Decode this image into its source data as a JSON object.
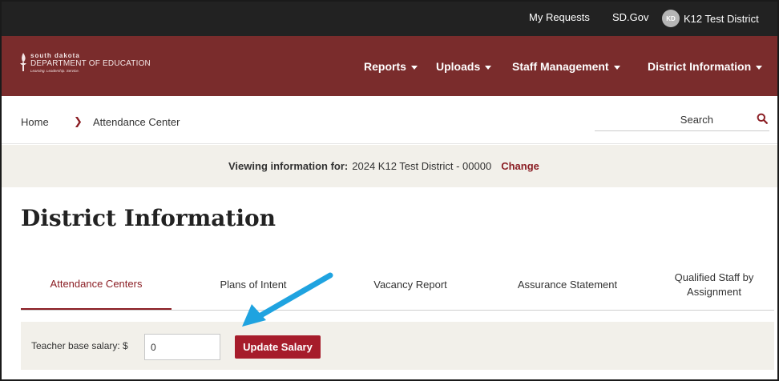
{
  "topbar": {
    "my_requests": "My Requests",
    "sd_gov": "SD.Gov",
    "user_initials": "KD",
    "user_name": "K12 Test District"
  },
  "logo": {
    "line1": "south dakota",
    "line2": "DEPARTMENT OF EDUCATION",
    "tagline": "Learning. Leadership. Service."
  },
  "nav": {
    "reports": "Reports",
    "uploads": "Uploads",
    "staff_management": "Staff Management",
    "district_information": "District Information"
  },
  "breadcrumb": {
    "home": "Home",
    "separator": "❯",
    "current": "Attendance Center"
  },
  "search": {
    "placeholder": "Search"
  },
  "viewing": {
    "label": "Viewing information for:",
    "value": "2024 K12 Test District - 00000",
    "change_link": "Change"
  },
  "page_title": "District Information",
  "tabs": [
    {
      "label": "Attendance Centers",
      "active": true
    },
    {
      "label": "Plans of Intent",
      "active": false
    },
    {
      "label": "Vacancy Report",
      "active": false
    },
    {
      "label": "Assurance Statement",
      "active": false
    },
    {
      "label": "Qualified Staff by Assignment",
      "active": false
    }
  ],
  "salary": {
    "label": "Teacher base salary: $",
    "value": "0",
    "button_label": "Update Salary"
  },
  "colors": {
    "topbar": "#222222",
    "navbar": "#7a2c2c",
    "accent": "#8b1e24",
    "button": "#a61c2b",
    "panel": "#f2f0ea",
    "annotation_arrow": "#1fa3e0"
  }
}
